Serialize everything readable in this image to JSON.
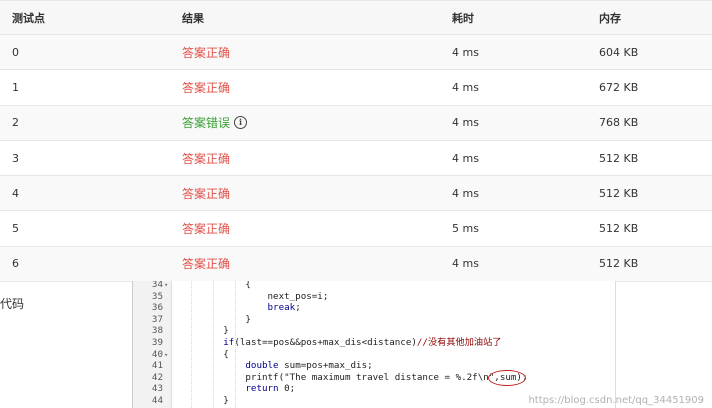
{
  "table": {
    "headers": [
      "测试点",
      "结果",
      "耗时",
      "内存"
    ],
    "rows": [
      {
        "point": "0",
        "result": "答案正确",
        "status": "correct",
        "time": "4 ms",
        "memory": "604 KB"
      },
      {
        "point": "1",
        "result": "答案正确",
        "status": "correct",
        "time": "4 ms",
        "memory": "672 KB"
      },
      {
        "point": "2",
        "result": "答案错误",
        "status": "wrong",
        "time": "4 ms",
        "memory": "768 KB"
      },
      {
        "point": "3",
        "result": "答案正确",
        "status": "correct",
        "time": "4 ms",
        "memory": "512 KB"
      },
      {
        "point": "4",
        "result": "答案正确",
        "status": "correct",
        "time": "4 ms",
        "memory": "512 KB"
      },
      {
        "point": "5",
        "result": "答案正确",
        "status": "correct",
        "time": "5 ms",
        "memory": "512 KB"
      },
      {
        "point": "6",
        "result": "答案正确",
        "status": "correct",
        "time": "4 ms",
        "memory": "512 KB"
      }
    ],
    "info_icon": "info-circle-icon"
  },
  "code_label": "代码",
  "code": {
    "lines": [
      {
        "num": "34",
        "fold": true,
        "text": "            {"
      },
      {
        "num": "35",
        "fold": false,
        "text": "                next_pos=i;"
      },
      {
        "num": "36",
        "fold": false,
        "text": "                break;"
      },
      {
        "num": "37",
        "fold": false,
        "text": "            }"
      },
      {
        "num": "38",
        "fold": false,
        "text": "        }"
      },
      {
        "num": "39",
        "fold": false,
        "text": "        if(last==pos&&pos+max_dis<distance)//没有其他加油站了"
      },
      {
        "num": "40",
        "fold": true,
        "text": "        {"
      },
      {
        "num": "41",
        "fold": false,
        "text": "            double sum=pos+max_dis;"
      },
      {
        "num": "42",
        "fold": false,
        "text": "            printf(\"The maximum travel distance = %.2f\\n\",sum);"
      },
      {
        "num": "43",
        "fold": false,
        "text": "            return 0;"
      },
      {
        "num": "44",
        "fold": false,
        "text": "        }"
      }
    ]
  },
  "watermark": "https://blog.csdn.net/qq_34451909",
  "colors": {
    "correct": "#e2514a",
    "wrong": "#3aa035"
  }
}
